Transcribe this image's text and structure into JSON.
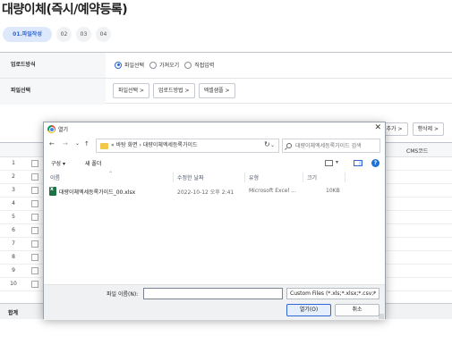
{
  "page": {
    "title": "대량이체(즉시/예약등록)",
    "steps": [
      {
        "label": "01.파일작성",
        "active": true
      },
      {
        "label": "02",
        "active": false
      },
      {
        "label": "03",
        "active": false
      },
      {
        "label": "04",
        "active": false
      }
    ],
    "form": {
      "upload_method_label": "업로드방식",
      "upload_options": [
        {
          "label": "파일선택",
          "selected": true
        },
        {
          "label": "가져오기",
          "selected": false
        },
        {
          "label": "직접입력",
          "selected": false
        }
      ],
      "file_select_label": "파일선택",
      "file_buttons": [
        "파일선택 >",
        "업로드방법 >",
        "엑셀샘플 >"
      ]
    },
    "right_buttons": [
      "행추가 >",
      "행삭제 >"
    ],
    "grid": {
      "cms_header": "CMS코드",
      "row_numbers": [
        "1",
        "2",
        "3",
        "4",
        "5",
        "6",
        "7",
        "8",
        "9",
        "10"
      ],
      "footer_label": "합계"
    }
  },
  "dialog": {
    "title": "열기",
    "close_glyph": "✕",
    "nav": {
      "back": "←",
      "forward": "→",
      "dropdown": "⌄",
      "up": "↑",
      "address_path": "«  바탕 화면  ›  대량이체엑세등록가이드",
      "address_dropdown": "⌄",
      "refresh": "↻",
      "search_placeholder": "대량이체엑세등록가이드 검색"
    },
    "toolbar": {
      "organize": "구성 ▾",
      "new_folder": "새 폴더",
      "view_dropdown": "▾",
      "help": "?"
    },
    "columns": [
      "이름",
      "수정한 날짜",
      "유형",
      "크기"
    ],
    "files": [
      {
        "name": "대량이체엑세등록가이드_00.xlsx",
        "modified": "2022-10-12 오후 2:41",
        "type": "Microsoft Excel ...",
        "size": "10KB"
      }
    ],
    "footer": {
      "filename_label": "파일 이름(N):",
      "filename_value": "",
      "filter_value": "Custom Files (*.xls;*.xlsx;*.csv;*",
      "filter_dropdown": "⌄",
      "open_label": "열기(O)",
      "cancel_label": "취소"
    }
  }
}
